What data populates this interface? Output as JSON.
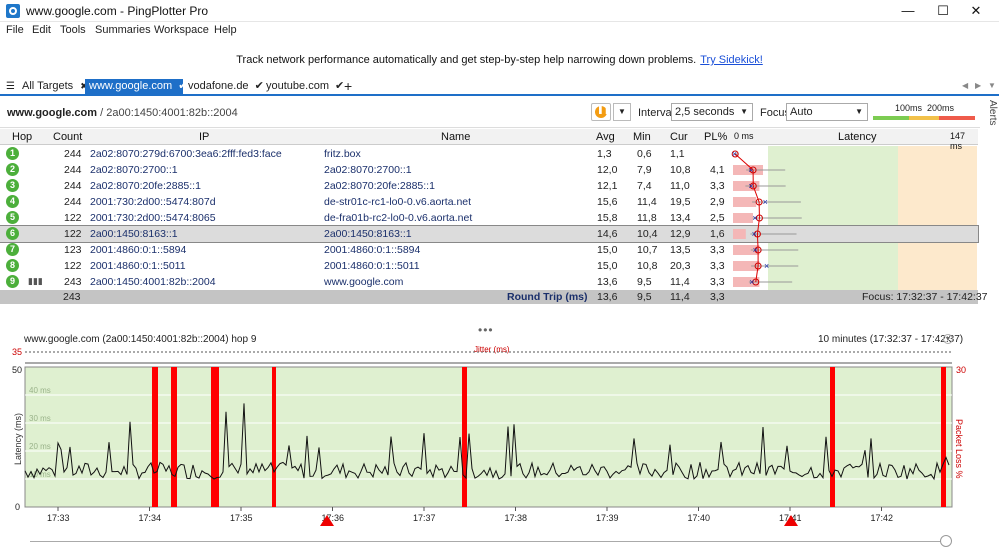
{
  "window": {
    "title": "www.google.com - PingPlotter Pro",
    "min": "—",
    "max": "☐",
    "close": "✕"
  },
  "menu": [
    "File",
    "Edit",
    "Tools",
    "Summaries",
    "Workspace",
    "Help"
  ],
  "banner": {
    "text": "Track network performance automatically and get step-by-step help narrowing down problems.",
    "link": "Try Sidekick!"
  },
  "tabs": {
    "all_targets": "All Targets",
    "items": [
      {
        "label": "www.google.com",
        "mark": "✔",
        "active": true
      },
      {
        "label": "vodafone.de",
        "mark": "✔"
      },
      {
        "label": "youtube.com",
        "mark": "✔"
      }
    ],
    "add": "+",
    "close_all": "✖"
  },
  "target": {
    "host": "www.google.com",
    "path": "/ 2a00:1450:4001:82b::2004",
    "interval_label": "Interval",
    "interval_value": "2,5 seconds",
    "focus_label": "Focus",
    "focus_value": "Auto",
    "thresh_100": "100ms",
    "thresh_200": "200ms"
  },
  "columns": {
    "hop": "Hop",
    "count": "Count",
    "ip": "IP",
    "name": "Name",
    "avg": "Avg",
    "min": "Min",
    "cur": "Cur",
    "pl": "PL%",
    "lat_start": "0 ms",
    "latency": "Latency",
    "lat_end": "147 ms"
  },
  "rows": [
    {
      "hop": "1",
      "count": "244",
      "ip": "2a02:8070:279d:6700:3ea6:2fff:fed3:face",
      "name": "fritz.box",
      "avg": "1,3",
      "min": "0,6",
      "cur": "1,1",
      "pl": ""
    },
    {
      "hop": "2",
      "count": "244",
      "ip": "2a02:8070:2700::1",
      "name": "2a02:8070:2700::1",
      "avg": "12,0",
      "min": "7,9",
      "cur": "10,8",
      "pl": "4,1"
    },
    {
      "hop": "3",
      "count": "244",
      "ip": "2a02:8070:20fe:2885::1",
      "name": "2a02:8070:20fe:2885::1",
      "avg": "12,1",
      "min": "7,4",
      "cur": "11,0",
      "pl": "3,3"
    },
    {
      "hop": "4",
      "count": "244",
      "ip": "2001:730:2d00::5474:807d",
      "name": "de-str01c-rc1-lo0-0.v6.aorta.net",
      "avg": "15,6",
      "min": "11,4",
      "cur": "19,5",
      "pl": "2,9"
    },
    {
      "hop": "5",
      "count": "122",
      "ip": "2001:730:2d00::5474:8065",
      "name": "de-fra01b-rc2-lo0-0.v6.aorta.net",
      "avg": "15,8",
      "min": "11,8",
      "cur": "13,4",
      "pl": "2,5"
    },
    {
      "hop": "6",
      "count": "122",
      "ip": "2a00:1450:8163::1",
      "name": "2a00:1450:8163::1",
      "avg": "14,6",
      "min": "10,4",
      "cur": "12,9",
      "pl": "1,6"
    },
    {
      "hop": "7",
      "count": "123",
      "ip": "2001:4860:0:1::5894",
      "name": "2001:4860:0:1::5894",
      "avg": "15,0",
      "min": "10,7",
      "cur": "13,5",
      "pl": "3,3"
    },
    {
      "hop": "8",
      "count": "122",
      "ip": "2001:4860:0:1::5011",
      "name": "2001:4860:0:1::5011",
      "avg": "15,0",
      "min": "10,8",
      "cur": "20,3",
      "pl": "3,3"
    },
    {
      "hop": "9",
      "count": "243",
      "ip": "2a00:1450:4001:82b::2004",
      "name": "www.google.com",
      "avg": "13,6",
      "min": "9,5",
      "cur": "11,4",
      "pl": "3,3"
    }
  ],
  "summary": {
    "count": "243",
    "label": "Round Trip (ms)",
    "avg": "13,6",
    "min": "9,5",
    "cur": "11,4",
    "pl": "3,3",
    "focus": "Focus: 17:32:37 - 17:42:37"
  },
  "graph": {
    "title": "www.google.com (2a00:1450:4001:82b::2004) hop 9",
    "range": "10 minutes (17:32:37 - 17:42:37)",
    "jitter_label": "Jitter (ms)",
    "jitter_max": "35",
    "y_label": "Latency (ms)",
    "y_right_label": "Packet Loss %",
    "y_top": "50",
    "y_zero": "0",
    "y_right_top": "30",
    "gridlines": [
      "40 ms",
      "30 ms",
      "20 ms",
      "10 ms"
    ],
    "x_ticks": [
      "17:33",
      "17:34",
      "17:35",
      "17:36",
      "17:37",
      "17:38",
      "17:39",
      "17:40",
      "17:41",
      "17:42"
    ],
    "alerts_side": "Alerts"
  },
  "colors": {
    "accent": "#1e6fc8",
    "hop_green": "#4caf3b",
    "good_zone": "#dff0d0",
    "warn_zone": "#fde9cc",
    "loss_red": "#ff0000",
    "bar_pink": "#f4b7b7"
  }
}
